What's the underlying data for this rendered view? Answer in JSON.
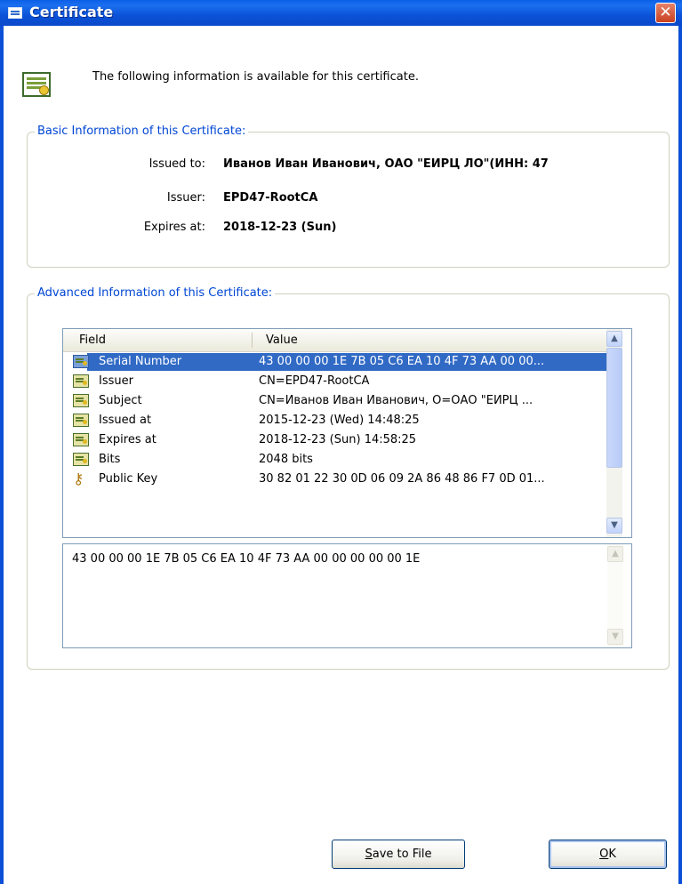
{
  "window": {
    "title": "Certificate",
    "close_glyph": "✕"
  },
  "header": {
    "text": "The following information is available for this certificate."
  },
  "basic": {
    "legend": "Basic Information of this Certificate:",
    "issued_to_label": "Issued to:",
    "issued_to_value": "Иванов Иван Иванович, ОАО \"ЕИРЦ ЛО\"(ИНН: 47",
    "issuer_label": "Issuer:",
    "issuer_value": "EPD47-RootCA",
    "expires_label": "Expires at:",
    "expires_value": "2018-12-23 (Sun)"
  },
  "advanced": {
    "legend": "Advanced Information of this Certificate:",
    "columns": {
      "field": "Field",
      "value": "Value"
    },
    "rows": [
      {
        "field": "Serial Number",
        "value": "43 00 00 00 1E 7B 05 C6 EA 10 4F 73 AA 00 00...",
        "selected": true
      },
      {
        "field": "Issuer",
        "value": "CN=EPD47-RootCA"
      },
      {
        "field": "Subject",
        "value": "CN=Иванов Иван Иванович, O=ОАО \"ЕИРЦ ..."
      },
      {
        "field": "Issued at",
        "value": "2015-12-23 (Wed) 14:48:25"
      },
      {
        "field": "Expires at",
        "value": "2018-12-23 (Sun) 14:58:25"
      },
      {
        "field": "Bits",
        "value": "2048 bits"
      },
      {
        "field": "Public Key",
        "value": "30 82 01 22 30 0D 06 09 2A 86 48 86 F7 0D 01..."
      }
    ],
    "detail_text": "43 00 00 00 1E 7B 05 C6 EA 10 4F 73 AA 00 00 00 00 00 1E"
  },
  "buttons": {
    "save_mnemonic": "S",
    "save_rest": "ave to File",
    "ok_mnemonic": "O",
    "ok_rest": "K"
  },
  "icons": {
    "title": "certificate-icon",
    "header": "certificate-icon",
    "row": "certificate-field-icon",
    "public_key": "key-icon"
  },
  "colors": {
    "titlebar": "#0a55dc",
    "legend_text": "#0046d5",
    "selection": "#316ac5"
  }
}
